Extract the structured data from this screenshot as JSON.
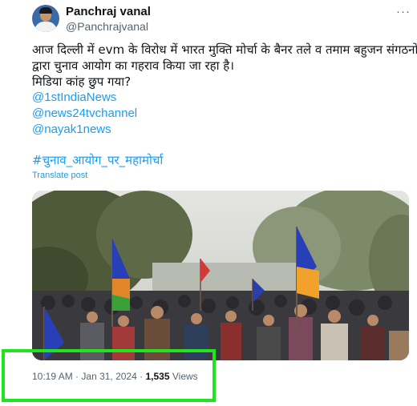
{
  "author": {
    "name": "Panchraj vanal",
    "handle": "@Panchrajvanal"
  },
  "more_icon": "more-horizontal-icon",
  "tweet": {
    "lines": [
      "आज दिल्ली में evm के विरोध में भारत मुक्ति मोर्चा के बैनर तले व तमाम बहुजन संगठनों",
      "द्वारा चुनाव आयोग का गहराव किया जा रहा है।",
      "मिडिया कांह छुप गया?"
    ],
    "mentions": [
      "@1stIndiaNews",
      "@news24tvchannel",
      "@nayak1news"
    ],
    "hashtag": "#चुनाव_आयोग_पर_महामोर्चा",
    "translate_label": "Translate post"
  },
  "photo": {
    "description_icon": "crowd-protest-photo"
  },
  "meta": {
    "time": "10:19 AM",
    "separator": "·",
    "date": "Jan 31, 2024",
    "separator2": "·",
    "views_count": "1,535",
    "views_label": "Views"
  },
  "colors": {
    "link": "#1d9bf0",
    "text": "#0f1419",
    "secondary": "#536471",
    "highlight": "#22e41c"
  }
}
